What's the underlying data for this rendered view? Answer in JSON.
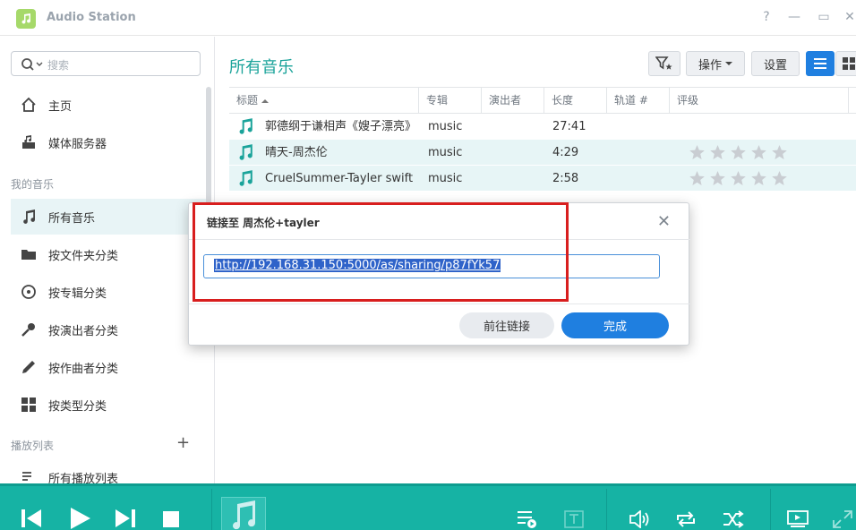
{
  "window": {
    "title": "Audio Station",
    "help": "?",
    "minimize": "—",
    "maximize": "▭",
    "close": "✕"
  },
  "sidebar": {
    "search_placeholder": "搜索",
    "items": [
      {
        "label": "主页",
        "icon": "home-icon"
      },
      {
        "label": "媒体服务器",
        "icon": "media-server-icon"
      }
    ],
    "section_my_music": "我的音乐",
    "music_items": [
      {
        "label": "所有音乐",
        "icon": "music-note-icon",
        "active": true
      },
      {
        "label": "按文件夹分类",
        "icon": "folder-icon"
      },
      {
        "label": "按专辑分类",
        "icon": "album-icon"
      },
      {
        "label": "按演出者分类",
        "icon": "microphone-icon"
      },
      {
        "label": "按作曲者分类",
        "icon": "pen-icon"
      },
      {
        "label": "按类型分类",
        "icon": "grid-icon"
      }
    ],
    "section_playlist": "播放列表",
    "add_playlist": "+",
    "partial_item": "所有播放列表"
  },
  "main": {
    "title": "所有音乐",
    "toolbar": {
      "filter_icon": "filter-star-icon",
      "action_label": "操作",
      "settings_label": "设置"
    },
    "columns": [
      "标题",
      "专辑",
      "演出者",
      "长度",
      "轨道 #",
      "评级"
    ],
    "rows": [
      {
        "title": "郭德纲于谦相声《嫂子漂亮》",
        "album": "music",
        "artist": "",
        "length": "27:41",
        "track": "",
        "rating": 0,
        "selected": false,
        "stars_visible": false
      },
      {
        "title": "晴天-周杰伦",
        "album": "music",
        "artist": "",
        "length": "4:29",
        "track": "",
        "rating": 0,
        "selected": true,
        "stars_visible": true
      },
      {
        "title": "CruelSummer-Tayler swift",
        "album": "music",
        "artist": "",
        "length": "2:58",
        "track": "",
        "rating": 0,
        "selected": true,
        "stars_visible": true
      }
    ]
  },
  "dialog": {
    "title": "链接至 周杰伦+tayler",
    "url": "http://192.168.31.150:5000/as/sharing/p87fYk57",
    "goto_label": "前往链接",
    "done_label": "完成"
  },
  "colors": {
    "accent": "#1aa39a",
    "player": "#16b3a4",
    "primary_button": "#1f7fe0",
    "highlight_box": "#d81e1e"
  }
}
